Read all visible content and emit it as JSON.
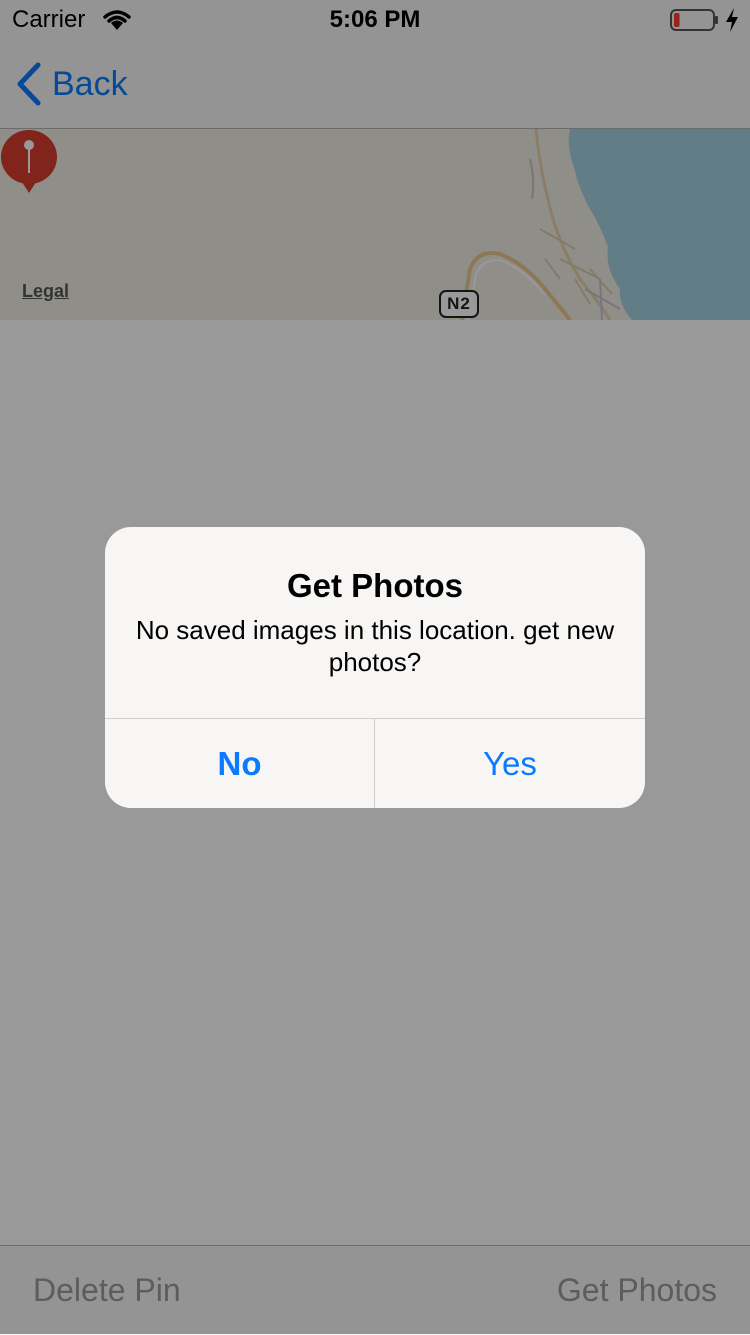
{
  "status_bar": {
    "carrier": "Carrier",
    "time": "5:06 PM",
    "wifi_icon": "wifi-icon",
    "battery_icon": "battery-low-icon",
    "charging_icon": "charging-bolt-icon",
    "battery_level_fraction": 0.15
  },
  "nav": {
    "back_label": "Back",
    "back_icon": "chevron-left-icon"
  },
  "map": {
    "legal_label": "Legal",
    "road_shield": "N2",
    "pin_icon": "map-pin-icon",
    "water_color": "#a3d0e0",
    "land_color": "#f1ede4",
    "pin_color": "#d63c2f"
  },
  "toolbar": {
    "delete_label": "Delete Pin",
    "get_photos_label": "Get Photos"
  },
  "alert": {
    "title": "Get Photos",
    "message": "No saved images in this location. get new photos?",
    "no_label": "No",
    "yes_label": "Yes",
    "accent_color": "#0a7aff"
  }
}
